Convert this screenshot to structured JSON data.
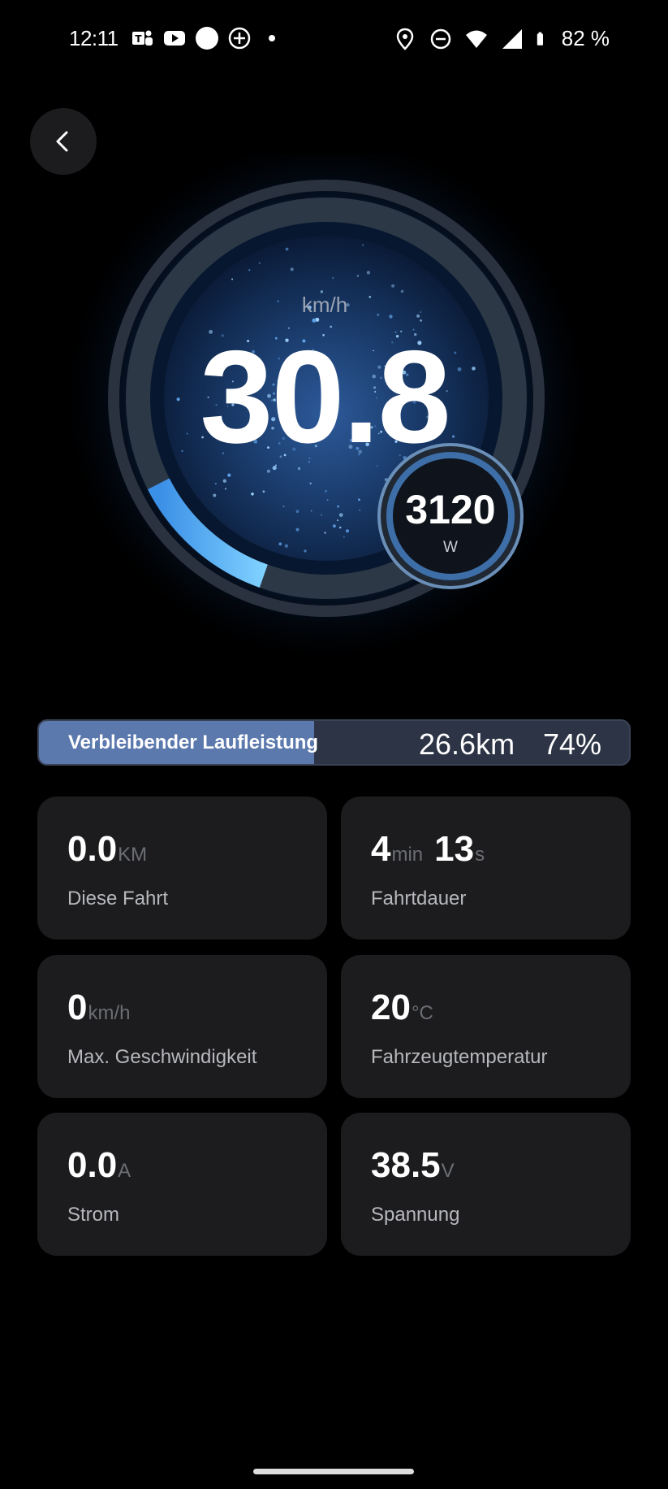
{
  "status_bar": {
    "time": "12:11",
    "battery_percent": "82 %",
    "left_icons": [
      "teams-icon",
      "youtube-icon",
      "yale-icon",
      "plus-circle-icon",
      "dot-icon"
    ],
    "right_icons": [
      "location-icon",
      "do-not-disturb-icon",
      "wifi-icon",
      "signal-icon",
      "battery-icon"
    ]
  },
  "gauge": {
    "speed_unit": "km/h",
    "speed": "30.8",
    "speed_fraction": 0.22,
    "power": "3120",
    "power_unit": "W"
  },
  "range": {
    "label": "Verbleibender Laufleistung",
    "distance": "26.6",
    "distance_unit": "km",
    "percent": "74%",
    "fill_fraction": 0.74
  },
  "cards": {
    "trip": {
      "value": "0.0",
      "unit": "KM",
      "label": "Diese Fahrt"
    },
    "duration": {
      "min_value": "4",
      "min_unit": "min",
      "sec_value": "13",
      "sec_unit": "s",
      "label": "Fahrtdauer"
    },
    "max_speed": {
      "value": "0",
      "unit": "km/h",
      "label": "Max. Geschwindigkeit"
    },
    "temperature": {
      "value": "20",
      "unit": "°C",
      "label": "Fahrzeugtemperatur"
    },
    "current": {
      "value": "0.0",
      "unit": "A",
      "label": "Strom"
    },
    "voltage": {
      "value": "38.5",
      "unit": "V",
      "label": "Spannung"
    }
  },
  "colors": {
    "background": "#000000",
    "card": "#1c1c1e",
    "accent_blue": "#4aa3f0",
    "range_fill": "#5b79ad"
  }
}
